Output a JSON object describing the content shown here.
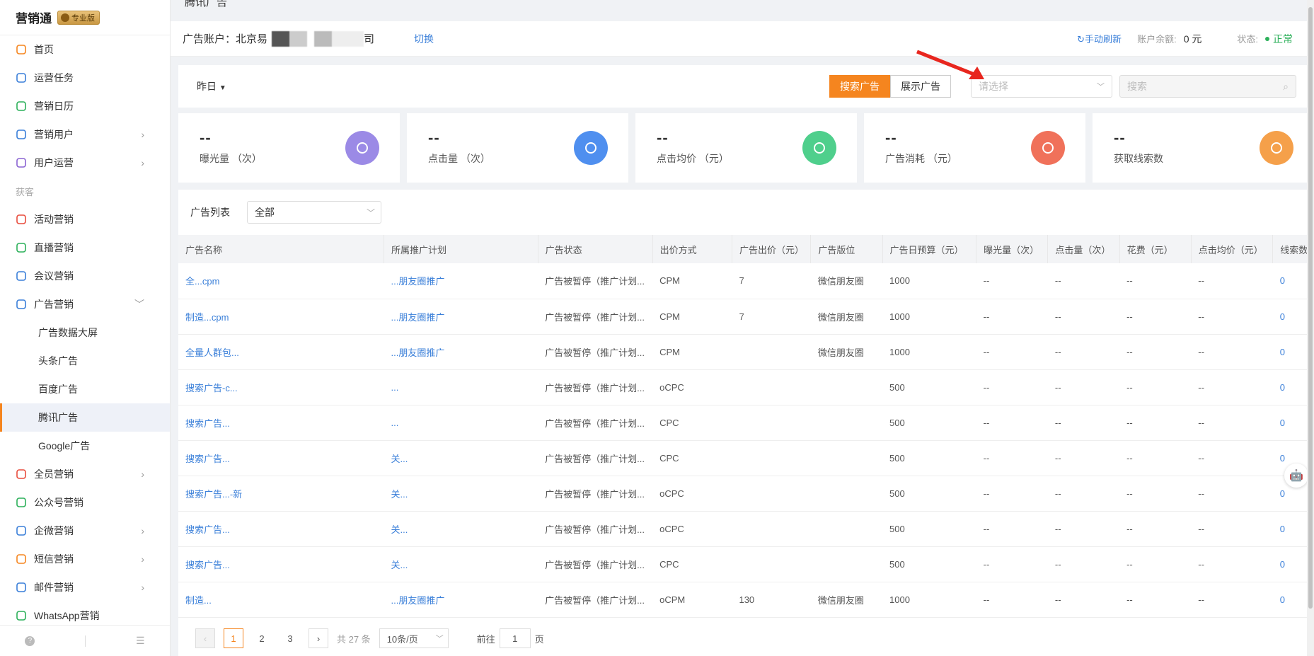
{
  "brand": {
    "name": "营销通",
    "badge": "专业版"
  },
  "nav": {
    "items": [
      {
        "label": "首页",
        "icon": "home-icon",
        "color": "#f5851f"
      },
      {
        "label": "运营任务",
        "icon": "task-icon",
        "color": "#3a7fd9"
      },
      {
        "label": "营销日历",
        "icon": "calendar-icon",
        "color": "#2cb05a"
      },
      {
        "label": "营销用户",
        "icon": "users-icon",
        "color": "#3a7fd9"
      },
      {
        "label": "用户运营",
        "icon": "user-ops-icon",
        "color": "#8a63d2"
      }
    ],
    "group": "获客",
    "items2": [
      {
        "label": "活动营销",
        "icon": "activity-icon",
        "color": "#e84c3d"
      },
      {
        "label": "直播营销",
        "icon": "live-icon",
        "color": "#2cb05a"
      },
      {
        "label": "会议营销",
        "icon": "meeting-icon",
        "color": "#3a7fd9"
      },
      {
        "label": "广告营销",
        "icon": "ad-icon",
        "color": "#3a7fd9"
      }
    ],
    "sub": [
      "广告数据大屏",
      "头条广告",
      "百度广告",
      "腾讯广告",
      "Google广告"
    ],
    "items3": [
      {
        "label": "全员营销",
        "icon": "all-staff-icon",
        "color": "#e84c3d"
      },
      {
        "label": "公众号营销",
        "icon": "wechat-icon",
        "color": "#2cb05a"
      },
      {
        "label": "企微营销",
        "icon": "wecom-icon",
        "color": "#3a7fd9"
      },
      {
        "label": "短信营销",
        "icon": "sms-icon",
        "color": "#f5851f"
      },
      {
        "label": "邮件营销",
        "icon": "mail-icon",
        "color": "#3a7fd9"
      },
      {
        "label": "WhatsApp营销",
        "icon": "whatsapp-icon",
        "color": "#2cb05a"
      }
    ]
  },
  "crumb": "腾讯广告",
  "account": {
    "label": "广告账户：北京易",
    "tail": "司",
    "switch": "切换",
    "refresh": "手动刷新",
    "balance_label": "账户余额:",
    "balance": "0 元",
    "status_label": "状态:",
    "status": "正常"
  },
  "filter": {
    "date": "昨日",
    "tabs": [
      "搜索广告",
      "展示广告"
    ],
    "select_placeholder": "请选择",
    "search_placeholder": "搜索"
  },
  "stats": [
    {
      "value": "--",
      "label": "曝光量 （次）",
      "color": "#9b8ae6",
      "icon": "eye-icon"
    },
    {
      "value": "--",
      "label": "点击量 （次）",
      "color": "#4f8fef",
      "icon": "click-icon"
    },
    {
      "value": "--",
      "label": "点击均价 （元）",
      "color": "#4fcf8c",
      "icon": "yuan-icon"
    },
    {
      "value": "--",
      "label": "广告消耗 （元）",
      "color": "#f0715a",
      "icon": "money-bag-icon"
    },
    {
      "value": "--",
      "label": "获取线索数",
      "color": "#f5a04a",
      "icon": "leads-icon"
    }
  ],
  "list": {
    "title": "广告列表",
    "filter": "全部",
    "columns": [
      "广告名称",
      "所属推广计划",
      "广告状态",
      "出价方式",
      "广告出价（元）",
      "广告版位",
      "广告日预算（元）",
      "曝光量（次）",
      "点击量（次）",
      "花费（元）",
      "点击均价（元）",
      "线索数"
    ],
    "rows": [
      [
        "全...cpm",
        "...朋友圈推广",
        "广告被暂停（推广计划...",
        "CPM",
        "7",
        "微信朋友圈",
        "1000",
        "--",
        "--",
        "--",
        "--",
        "0"
      ],
      [
        "制造...cpm",
        "...朋友圈推广",
        "广告被暂停（推广计划...",
        "CPM",
        "7",
        "微信朋友圈",
        "1000",
        "--",
        "--",
        "--",
        "--",
        "0"
      ],
      [
        "全量人群包...",
        "...朋友圈推广",
        "广告被暂停（推广计划...",
        "CPM",
        "",
        "微信朋友圈",
        "1000",
        "--",
        "--",
        "--",
        "--",
        "0"
      ],
      [
        "搜索广告-c...",
        "...",
        "广告被暂停（推广计划...",
        "oCPC",
        "",
        "",
        "500",
        "--",
        "--",
        "--",
        "--",
        "0"
      ],
      [
        "搜索广告...",
        "...",
        "广告被暂停（推广计划...",
        "CPC",
        "",
        "",
        "500",
        "--",
        "--",
        "--",
        "--",
        "0"
      ],
      [
        "搜索广告...",
        "关...",
        "广告被暂停（推广计划...",
        "CPC",
        "",
        "",
        "500",
        "--",
        "--",
        "--",
        "--",
        "0"
      ],
      [
        "搜索广告...-新",
        "关...",
        "广告被暂停（推广计划...",
        "oCPC",
        "",
        "",
        "500",
        "--",
        "--",
        "--",
        "--",
        "0"
      ],
      [
        "搜索广告...",
        "关...",
        "广告被暂停（推广计划...",
        "oCPC",
        "",
        "",
        "500",
        "--",
        "--",
        "--",
        "--",
        "0"
      ],
      [
        "搜索广告...",
        "关...",
        "广告被暂停（推广计划...",
        "CPC",
        "",
        "",
        "500",
        "--",
        "--",
        "--",
        "--",
        "0"
      ],
      [
        "制造...",
        "...朋友圈推广",
        "广告被暂停（推广计划...",
        "oCPM",
        "130",
        "微信朋友圈",
        "1000",
        "--",
        "--",
        "--",
        "--",
        "0"
      ]
    ]
  },
  "pager": {
    "pages": [
      "1",
      "2",
      "3"
    ],
    "total": "共 27 条",
    "size": "10条/页",
    "goto": "前往",
    "goto_val": "1",
    "page_unit": "页"
  }
}
